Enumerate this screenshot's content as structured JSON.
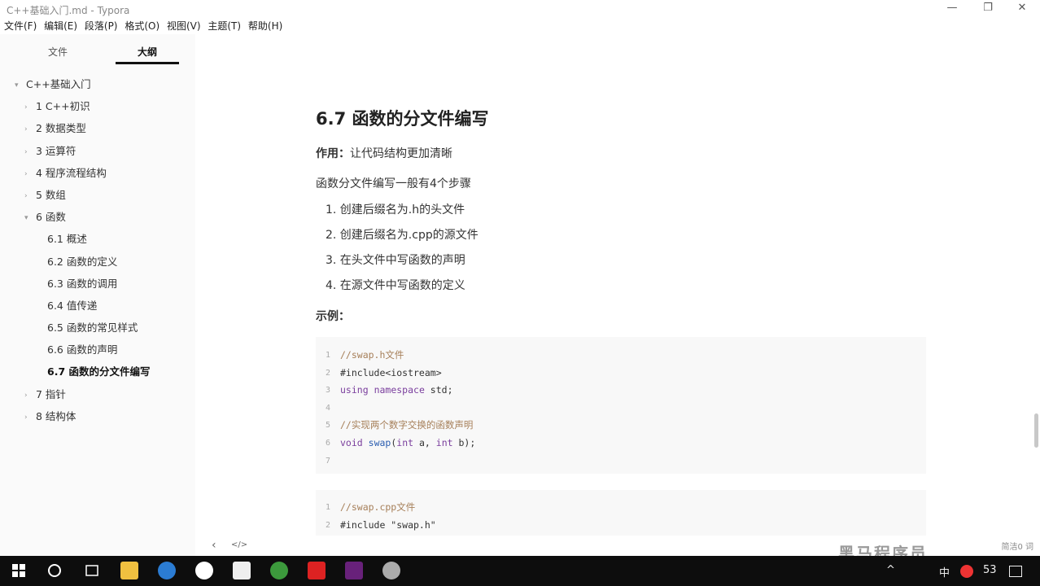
{
  "window": {
    "title": "C++基础入门.md - Typora",
    "minimize": "—",
    "maximize": "❐",
    "close": "✕"
  },
  "menu": [
    "文件(F)",
    "编辑(E)",
    "段落(P)",
    "格式(O)",
    "视图(V)",
    "主题(T)",
    "帮助(H)"
  ],
  "sidebar": {
    "tabs": [
      "文件",
      "大纲"
    ],
    "outline": [
      {
        "label": "C++基础入门",
        "level": 0,
        "arrow": "▾"
      },
      {
        "label": "1 C++初识",
        "level": 1,
        "arrow": "›"
      },
      {
        "label": "2 数据类型",
        "level": 1,
        "arrow": "›"
      },
      {
        "label": "3 运算符",
        "level": 1,
        "arrow": "›"
      },
      {
        "label": "4 程序流程结构",
        "level": 1,
        "arrow": "›"
      },
      {
        "label": "5 数组",
        "level": 1,
        "arrow": "›"
      },
      {
        "label": "6 函数",
        "level": 1,
        "arrow": "▾"
      },
      {
        "label": "6.1 概述",
        "level": 2,
        "arrow": ""
      },
      {
        "label": "6.2 函数的定义",
        "level": 2,
        "arrow": ""
      },
      {
        "label": "6.3 函数的调用",
        "level": 2,
        "arrow": ""
      },
      {
        "label": "6.4 值传递",
        "level": 2,
        "arrow": ""
      },
      {
        "label": "6.5 函数的常见样式",
        "level": 2,
        "arrow": ""
      },
      {
        "label": "6.6 函数的声明",
        "level": 2,
        "arrow": ""
      },
      {
        "label": "6.7 函数的分文件编写",
        "level": 2,
        "arrow": "",
        "current": true
      },
      {
        "label": "7 指针",
        "level": 1,
        "arrow": "›"
      },
      {
        "label": "8 结构体",
        "level": 1,
        "arrow": "›"
      }
    ]
  },
  "doc": {
    "heading": "6.7 函数的分文件编写",
    "purpose_label": "作用：",
    "purpose_text": "让代码结构更加清晰",
    "steps_intro": "函数分文件编写一般有4个步骤",
    "steps": [
      "1. 创建后缀名为.h的头文件",
      "2. 创建后缀名为.cpp的源文件",
      "3. 在头文件中写函数的声明",
      "4. 在源文件中写函数的定义"
    ],
    "example_label": "示例：",
    "code1": [
      {
        "n": "1",
        "text": "//swap.h文件"
      },
      {
        "n": "2",
        "text": "#include<iostream>"
      },
      {
        "n": "3",
        "text": "using namespace std;"
      },
      {
        "n": "4",
        "text": ""
      },
      {
        "n": "5",
        "text": "//实现两个数字交换的函数声明"
      },
      {
        "n": "6",
        "text": "void swap(int a, int b);"
      },
      {
        "n": "7",
        "text": ""
      }
    ],
    "code2": [
      {
        "n": "1",
        "text": "//swap.cpp文件"
      },
      {
        "n": "2",
        "text": "#include \"swap.h\""
      }
    ]
  },
  "statusbar": {
    "back": "‹",
    "source_toggle": "</>",
    "word_count": "简洁0 词"
  },
  "watermark": "黑马程序员",
  "tray": {
    "ime": "中",
    "temp": "53",
    "up_arrow": "^"
  },
  "colors": {
    "taskbar": "#0d0d0d",
    "sidebar": "#fafafa",
    "code_bg": "#f8f8f8",
    "comment": "#a67f59",
    "keyword": "#7a3e9d"
  }
}
